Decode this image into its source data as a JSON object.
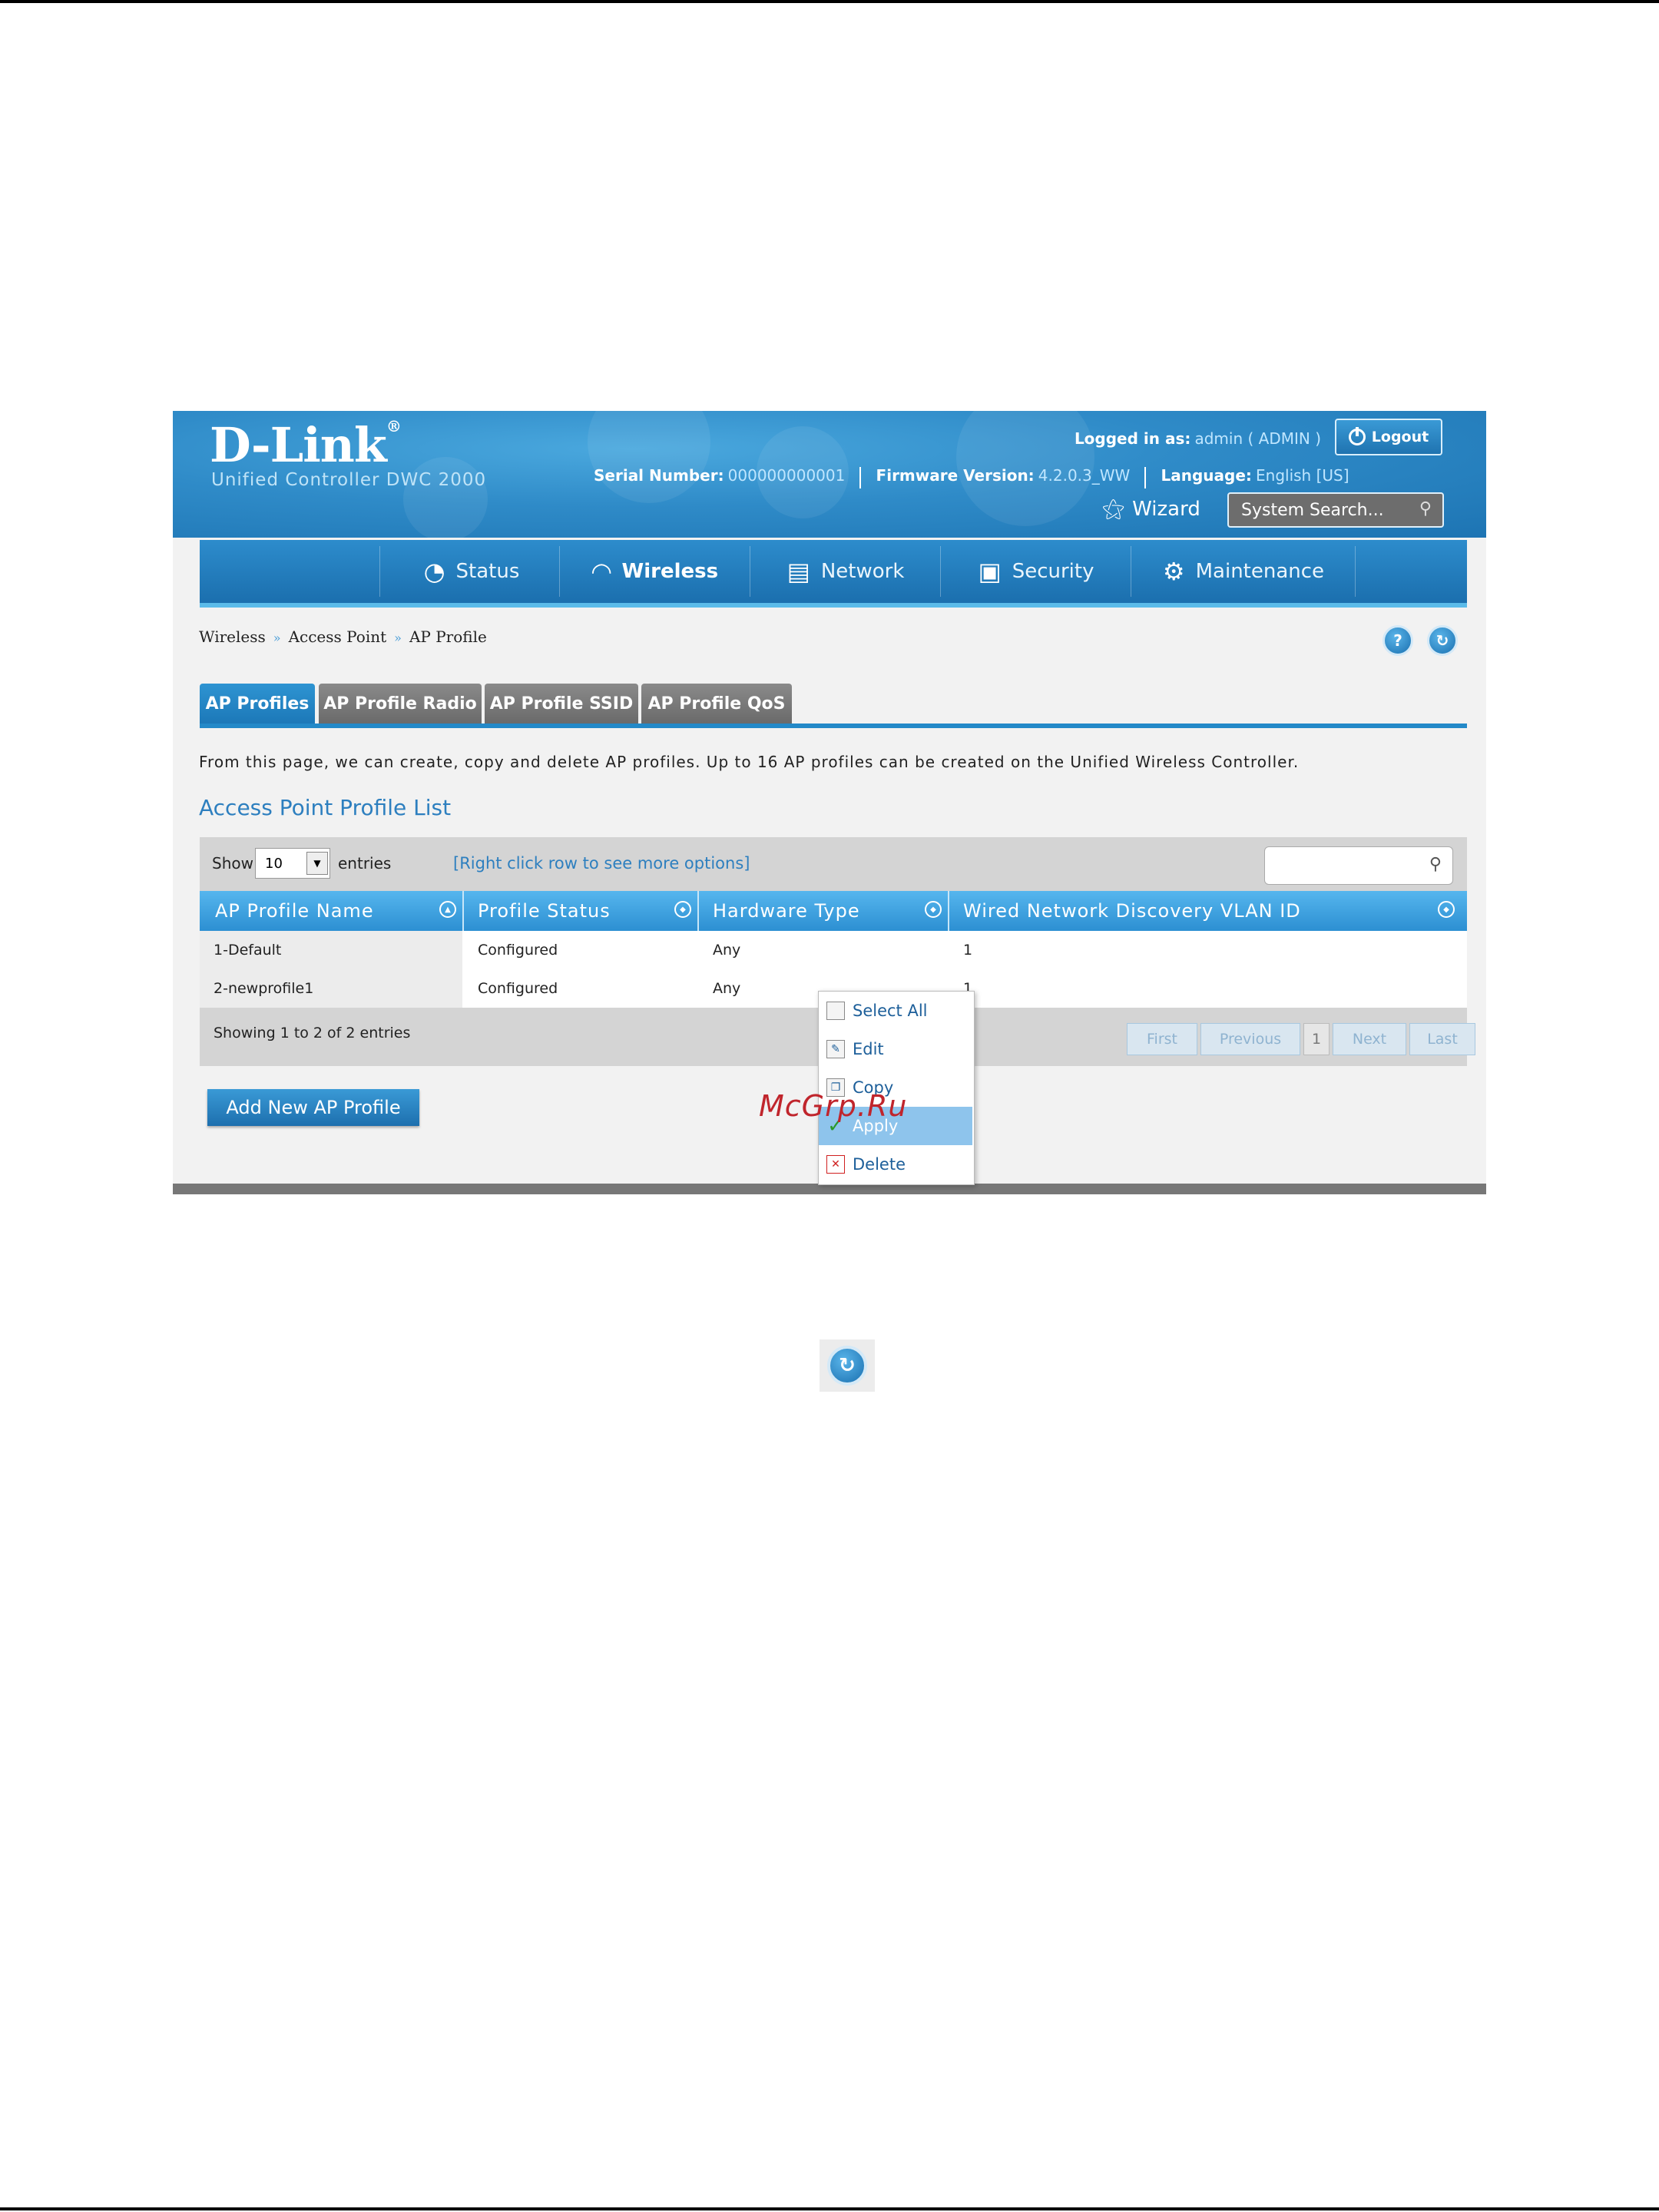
{
  "header": {
    "brand": "D-Link",
    "brand_mark": "®",
    "subtitle": "Unified Controller   DWC 2000",
    "logged_in_label": "Logged in as:",
    "logged_in_value": "admin ( ADMIN )",
    "logout_label": "Logout",
    "serial_label": "Serial Number:",
    "serial_value": "000000000001",
    "firmware_label": "Firmware Version:",
    "firmware_value": "4.2.0.3_WW",
    "language_label": "Language:",
    "language_value": "English [US]",
    "wizard_label": "Wizard",
    "search_placeholder": "System Search..."
  },
  "nav": [
    {
      "label": "Status",
      "icon": "gauge-icon"
    },
    {
      "label": "Wireless",
      "icon": "wifi-icon",
      "active": true
    },
    {
      "label": "Network",
      "icon": "monitor-icon"
    },
    {
      "label": "Security",
      "icon": "lock-icon"
    },
    {
      "label": "Maintenance",
      "icon": "gears-icon"
    }
  ],
  "breadcrumb": [
    "Wireless",
    "Access Point",
    "AP Profile"
  ],
  "breadcrumb_sep": "»",
  "tabs": [
    {
      "label": "AP Profiles",
      "active": true
    },
    {
      "label": "AP Profile Radio"
    },
    {
      "label": "AP Profile SSID"
    },
    {
      "label": "AP Profile QoS"
    }
  ],
  "description": "From this page, we can create, copy and delete AP profiles. Up to 16 AP profiles can be created on the Unified Wireless Controller.",
  "list_title": "Access Point Profile List",
  "toolbar": {
    "show_label": "Show",
    "entries_value": "10",
    "entries_label": "entries",
    "right_click_hint": "[Right click row to see more options]"
  },
  "table": {
    "columns": [
      "AP Profile Name",
      "Profile Status",
      "Hardware Type",
      "Wired Network Discovery VLAN ID"
    ],
    "rows": [
      [
        "1-Default",
        "Configured",
        "Any",
        "1"
      ],
      [
        "2-newprofile1",
        "Configured",
        "Any",
        "1"
      ]
    ]
  },
  "pagination": {
    "summary": "Showing 1 to 2 of 2 entries",
    "first": "First",
    "previous": "Previous",
    "page": "1",
    "next": "Next",
    "last": "Last"
  },
  "add_button": "Add New AP Profile",
  "context_menu": [
    {
      "label": "Select All",
      "icon": "checkbox-icon"
    },
    {
      "label": "Edit",
      "icon": "pencil-icon"
    },
    {
      "label": "Copy",
      "icon": "copy-icon"
    },
    {
      "label": "Apply",
      "icon": "check-icon",
      "highlighted": true
    },
    {
      "label": "Delete",
      "icon": "delete-icon"
    }
  ],
  "watermark": "McGrp.Ru",
  "colors": {
    "brand_blue": "#2389c8",
    "header_blue": "#2f8bc8",
    "link_blue": "#2d7fbf",
    "menu_highlight": "#8ec4ec"
  }
}
